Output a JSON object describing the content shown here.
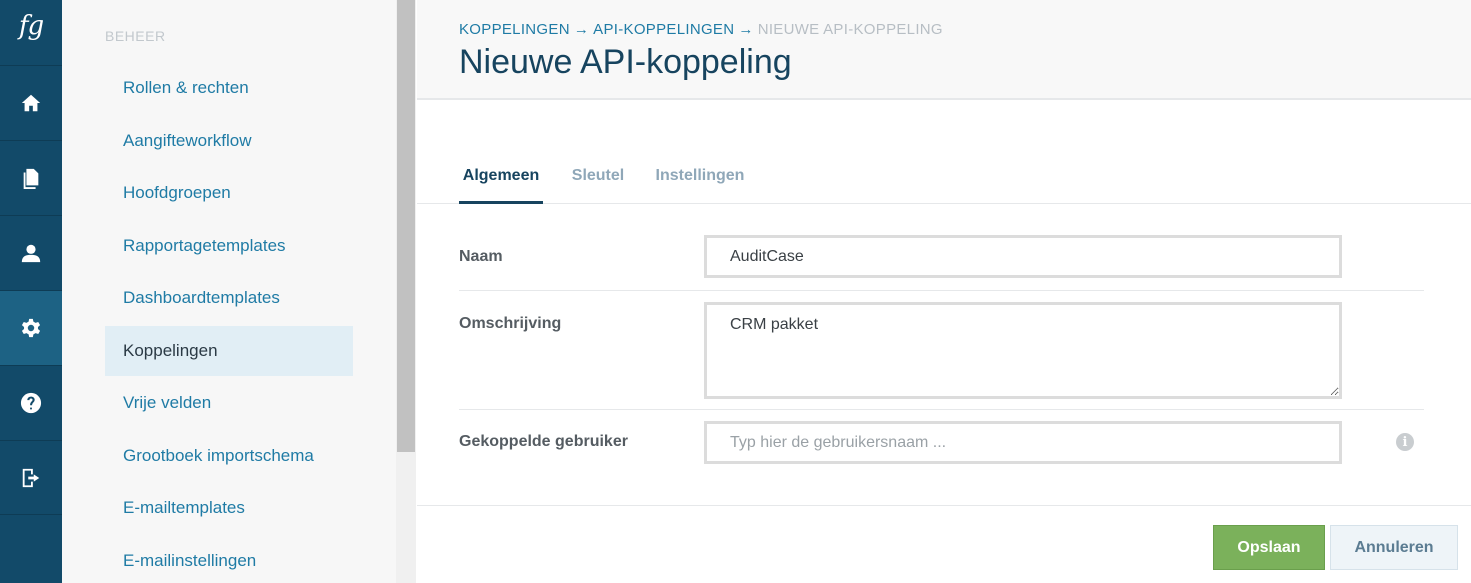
{
  "rail": {
    "logo": "fg",
    "items": [
      {
        "icon": "home-icon"
      },
      {
        "icon": "document-icon"
      },
      {
        "icon": "user-icon"
      },
      {
        "icon": "gear-icon"
      },
      {
        "icon": "help-icon"
      },
      {
        "icon": "logout-icon"
      }
    ],
    "active_index": 3
  },
  "subnav": {
    "section_title": "BEHEER",
    "items": [
      {
        "label": "Rollen & rechten"
      },
      {
        "label": "Aangifteworkflow"
      },
      {
        "label": "Hoofdgroepen"
      },
      {
        "label": "Rapportagetemplates"
      },
      {
        "label": "Dashboardtemplates"
      },
      {
        "label": "Koppelingen"
      },
      {
        "label": "Vrije velden"
      },
      {
        "label": "Grootboek importschema"
      },
      {
        "label": "E-mailtemplates"
      },
      {
        "label": "E-mailinstellingen"
      }
    ],
    "active_index": 5
  },
  "header": {
    "breadcrumb": {
      "first": "KOPPELINGEN",
      "second": "API-KOPPELINGEN",
      "current": "NIEUWE API-KOPPELING",
      "separator": "→"
    },
    "title": "Nieuwe API-koppeling"
  },
  "tabs": [
    {
      "label": "Algemeen"
    },
    {
      "label": "Sleutel"
    },
    {
      "label": "Instellingen"
    }
  ],
  "active_tab": 0,
  "form": {
    "naam": {
      "label": "Naam",
      "value": "AuditCase"
    },
    "omschrijving": {
      "label": "Omschrijving",
      "value": "CRM pakket"
    },
    "gebruiker": {
      "label": "Gekoppelde gebruiker",
      "value": "",
      "placeholder": "Typ hier de gebruikersnaam ..."
    },
    "info_icon": "i"
  },
  "actions": {
    "save_label": "Opslaan",
    "cancel_label": "Annuleren"
  },
  "colors": {
    "rail": "#124a69",
    "accent": "#1f7ba5",
    "save": "#7bb15b"
  }
}
